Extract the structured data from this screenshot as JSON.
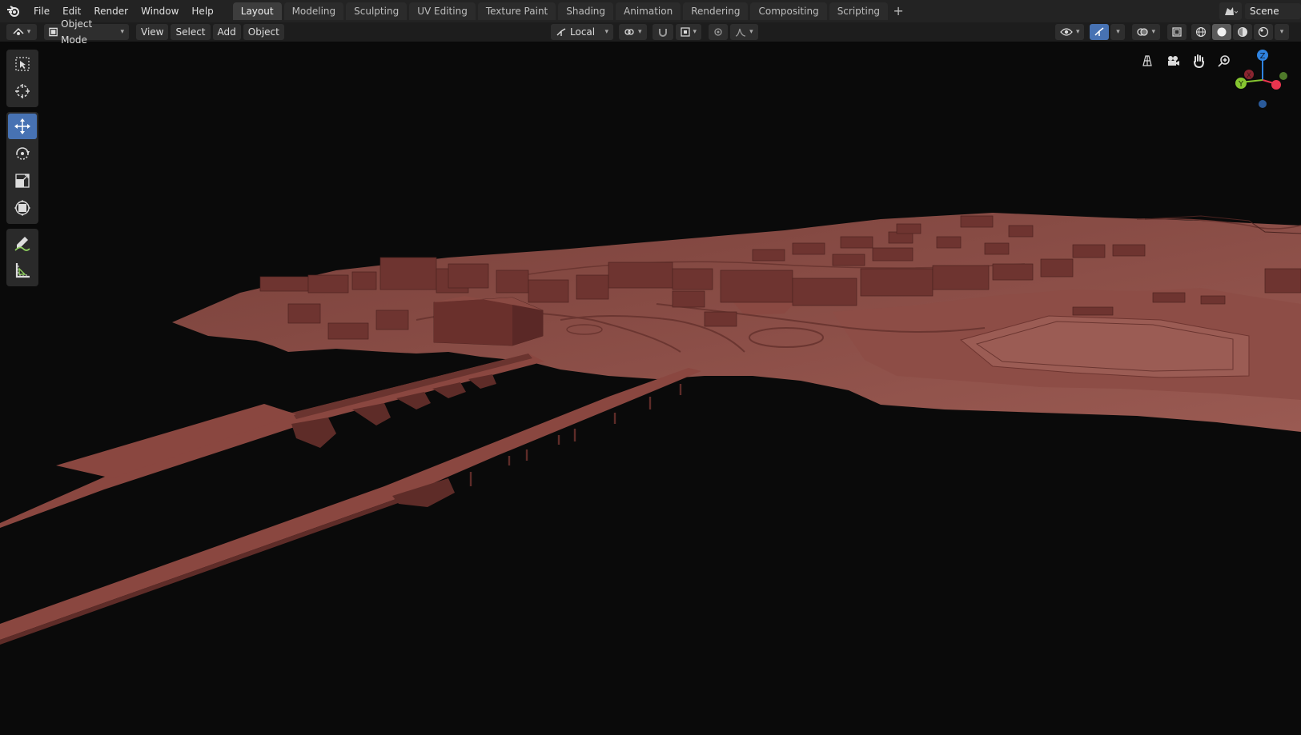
{
  "menu": [
    "File",
    "Edit",
    "Render",
    "Window",
    "Help"
  ],
  "workspaces": [
    {
      "label": "Layout",
      "active": true
    },
    {
      "label": "Modeling"
    },
    {
      "label": "Sculpting"
    },
    {
      "label": "UV Editing"
    },
    {
      "label": "Texture Paint"
    },
    {
      "label": "Shading"
    },
    {
      "label": "Animation"
    },
    {
      "label": "Rendering"
    },
    {
      "label": "Compositing"
    },
    {
      "label": "Scripting"
    }
  ],
  "scene": {
    "name": "Scene"
  },
  "header": {
    "mode_label": "Object Mode",
    "view_label": "View",
    "select_label": "Select",
    "add_label": "Add",
    "object_label": "Object",
    "orientation_label": "Local"
  },
  "gizmo": {
    "z_label": "Z",
    "y_label": "Y",
    "x_label": "X"
  },
  "colors": {
    "accent": "#4772b3",
    "model": "#8b4a43",
    "axis_x": "#e8354f",
    "axis_y": "#86c631",
    "axis_z": "#2f83e0"
  }
}
